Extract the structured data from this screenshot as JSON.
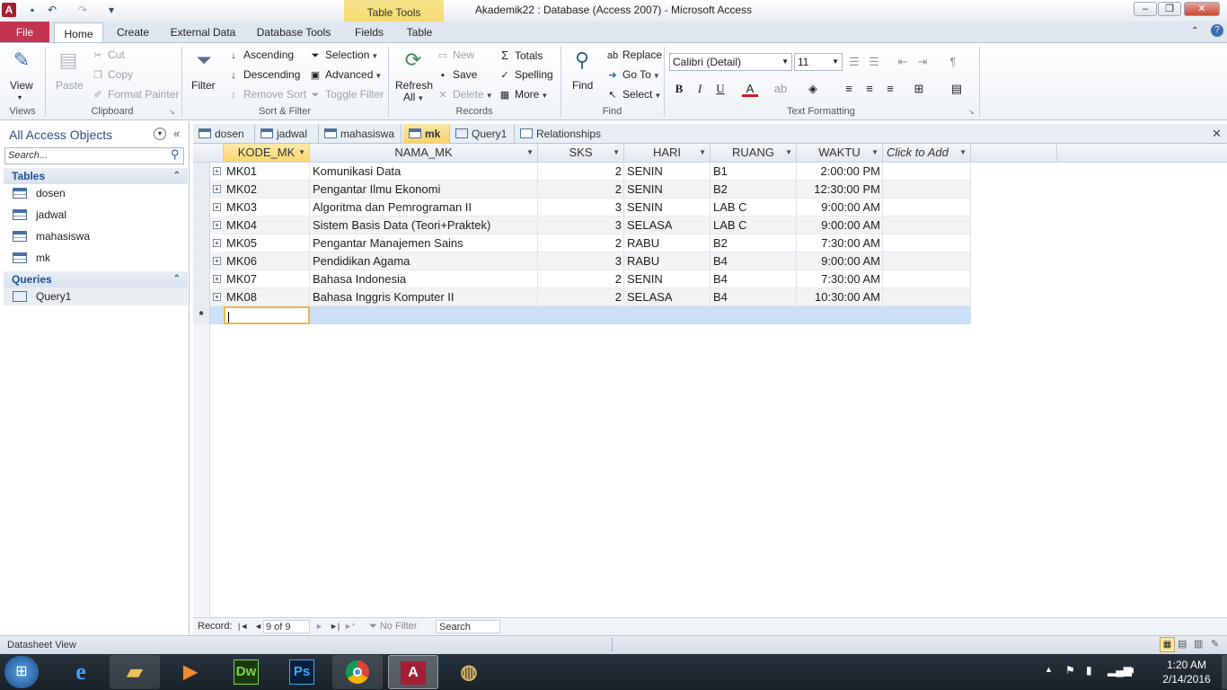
{
  "window": {
    "title": "Akademik22 : Database (Access 2007)  -  Microsoft Access",
    "contextual_tab": "Table Tools"
  },
  "ribbon_tabs": [
    "File",
    "Home",
    "Create",
    "External Data",
    "Database Tools",
    "Fields",
    "Table"
  ],
  "ribbon": {
    "views": {
      "view": "View",
      "label": "Views"
    },
    "clipboard": {
      "paste": "Paste",
      "cut": "Cut",
      "copy": "Copy",
      "format_painter": "Format Painter",
      "label": "Clipboard"
    },
    "sort_filter": {
      "filter": "Filter",
      "ascending": "Ascending",
      "descending": "Descending",
      "remove_sort": "Remove Sort",
      "selection": "Selection",
      "advanced": "Advanced",
      "toggle_filter": "Toggle Filter",
      "label": "Sort & Filter"
    },
    "records": {
      "refresh": "Refresh",
      "refresh_all": "All",
      "new": "New",
      "save": "Save",
      "delete": "Delete",
      "totals": "Totals",
      "spelling": "Spelling",
      "more": "More",
      "label": "Records"
    },
    "find": {
      "find": "Find",
      "replace": "Replace",
      "go_to": "Go To",
      "select": "Select",
      "label": "Find"
    },
    "text_formatting": {
      "font": "Calibri (Detail)",
      "size": "11",
      "label": "Text Formatting"
    }
  },
  "nav": {
    "header": "All Access Objects",
    "search_placeholder": "Search...",
    "groups": [
      {
        "name": "Tables",
        "items": [
          "dosen",
          "jadwal",
          "mahasiswa",
          "mk"
        ]
      },
      {
        "name": "Queries",
        "items": [
          "Query1"
        ]
      }
    ]
  },
  "doc_tabs": [
    "dosen",
    "jadwal",
    "mahasiswa",
    "mk",
    "Query1",
    "Relationships"
  ],
  "active_doc_tab": "mk",
  "table": {
    "columns": [
      "KODE_MK",
      "NAMA_MK",
      "SKS",
      "HARI",
      "RUANG",
      "WAKTU",
      "Click to Add"
    ],
    "rows": [
      [
        "MK01",
        "Komunikasi Data",
        "2",
        "SENIN",
        "B1",
        "2:00:00 PM"
      ],
      [
        "MK02",
        "Pengantar Ilmu Ekonomi",
        "2",
        "SENIN",
        "B2",
        "12:30:00 PM"
      ],
      [
        "MK03",
        "Algoritma dan Pemrograman II",
        "3",
        "SENIN",
        "LAB C",
        "9:00:00 AM"
      ],
      [
        "MK04",
        "Sistem Basis Data (Teori+Praktek)",
        "3",
        "SELASA",
        "LAB C",
        "9:00:00 AM"
      ],
      [
        "MK05",
        "Pengantar Manajemen Sains",
        "2",
        "RABU",
        "B2",
        "7:30:00 AM"
      ],
      [
        "MK06",
        "Pendidikan Agama",
        "3",
        "RABU",
        "B4",
        "9:00:00 AM"
      ],
      [
        "MK07",
        "Bahasa Indonesia",
        "2",
        "SENIN",
        "B4",
        "7:30:00 AM"
      ],
      [
        "MK08",
        "Bahasa Inggris Komputer II",
        "2",
        "SELASA",
        "B4",
        "10:30:00 AM"
      ]
    ],
    "new_row_marker": "*"
  },
  "record_nav": {
    "label": "Record:",
    "position": "9 of 9",
    "filter": "No Filter",
    "search": "Search"
  },
  "status": {
    "view": "Datasheet View"
  },
  "taskbar": {
    "apps": [
      "Dw",
      "Ps"
    ],
    "time": "1:20 AM",
    "date": "2/14/2016"
  }
}
